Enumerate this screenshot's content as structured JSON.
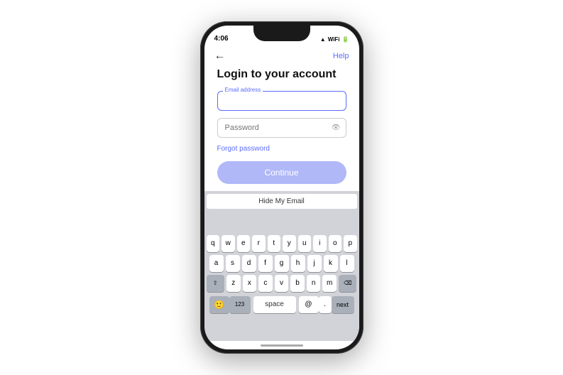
{
  "statusBar": {
    "time": "4:06",
    "wifiIcon": "wifi",
    "batteryIcon": "battery"
  },
  "nav": {
    "backIcon": "←",
    "helpLabel": "Help"
  },
  "login": {
    "title": "Login to your account",
    "emailLabel": "Email address",
    "emailPlaceholder": "|",
    "passwordLabel": "Password",
    "passwordPlaceholder": "Password",
    "forgotLabel": "Forgot password",
    "continueLabel": "Continue"
  },
  "keyboard": {
    "suggestion": "Hide My Email",
    "row1": [
      "q",
      "w",
      "e",
      "r",
      "t",
      "y",
      "u",
      "i",
      "o",
      "p"
    ],
    "row2": [
      "a",
      "s",
      "d",
      "f",
      "g",
      "h",
      "j",
      "k",
      "l"
    ],
    "row3": [
      "z",
      "x",
      "c",
      "v",
      "b",
      "n",
      "m"
    ],
    "bottomLeft": "123",
    "space": "space",
    "at": "@",
    "period": ".",
    "next": "next",
    "emoji": "🙂",
    "delete": "⌫",
    "shift": "⇧"
  },
  "colors": {
    "accent": "#5b6cff",
    "buttonDisabled": "#b0b8f8",
    "keyboardBg": "#d1d3d8"
  }
}
